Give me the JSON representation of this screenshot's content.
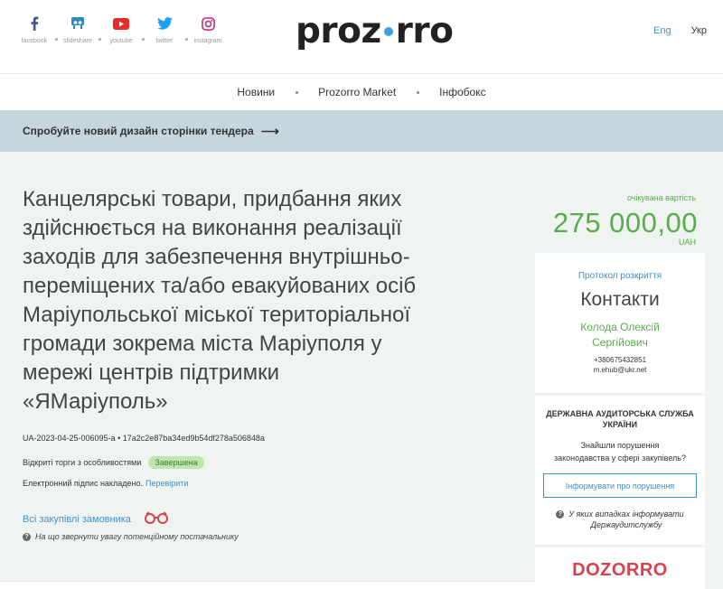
{
  "header": {
    "social": [
      {
        "label": "facebook",
        "icon": "facebook-icon",
        "color": "#3b5998"
      },
      {
        "label": "slideshare",
        "icon": "slideshare-icon",
        "color": "#2b8cc4"
      },
      {
        "label": "youtube",
        "icon": "youtube-icon",
        "color": "#e52d27"
      },
      {
        "label": "twitter",
        "icon": "twitter-icon",
        "color": "#1da1f2"
      },
      {
        "label": "instagram",
        "icon": "instagram-icon",
        "color": "#c13584"
      }
    ],
    "logo_left": "proz",
    "logo_right": "rro",
    "lang_eng": "Eng",
    "lang_ukr": "Укр"
  },
  "nav": {
    "items": [
      "Новини",
      "Prozorro Market",
      "Інфобокс"
    ]
  },
  "banner": {
    "text": "Спробуйте новий дизайн сторінки тендера",
    "arrow": "⟶"
  },
  "tender": {
    "title": "Канцелярські товари, придбання яких здійснюється на виконання реалізації заходів для забезпечення внутрішньо-переміщених та/або евакуйованих осіб Маріупольської міської територіальної громади зокрема міста Маріуполя у мережі центрів підтримки «ЯМаріуполь»",
    "id": "UA-2023-04-25-006095-a",
    "hash": "17a2c2e87ba34ed9b54df278a506848a",
    "procedure": "Відкриті торги з особливостями",
    "status": "Завершена",
    "signature": "Електронний підпис накладено.",
    "check": "Перевірити",
    "all_purchases": "Всі закупівлі замовника",
    "hint": "На що звернути увагу потенційному постачальнику"
  },
  "budget": {
    "label": "очікувана вартість",
    "value": "275 000,00",
    "currency": "UAH"
  },
  "contacts": {
    "protocol": "Протокол розкриття",
    "title": "Контакти",
    "name_line1": "Колода Олексій",
    "name_line2": "Сергійович",
    "phone": "+380675432851",
    "email": "m.ehub@ukr.net"
  },
  "audit": {
    "org_line1": "ДЕРЖАВНА АУДИТОРСЬКА СЛУЖБА",
    "org_line2": "УКРАЇНИ",
    "question_line1": "Знайшли порушення",
    "question_line2": "законодавства у сфері закупівель?",
    "button": "Інформувати про порушення",
    "note_line1": "У яких випадках інформувати",
    "note_line2": "Держаудитслужбу"
  },
  "dozorro": {
    "logo": "DOZORRO"
  }
}
